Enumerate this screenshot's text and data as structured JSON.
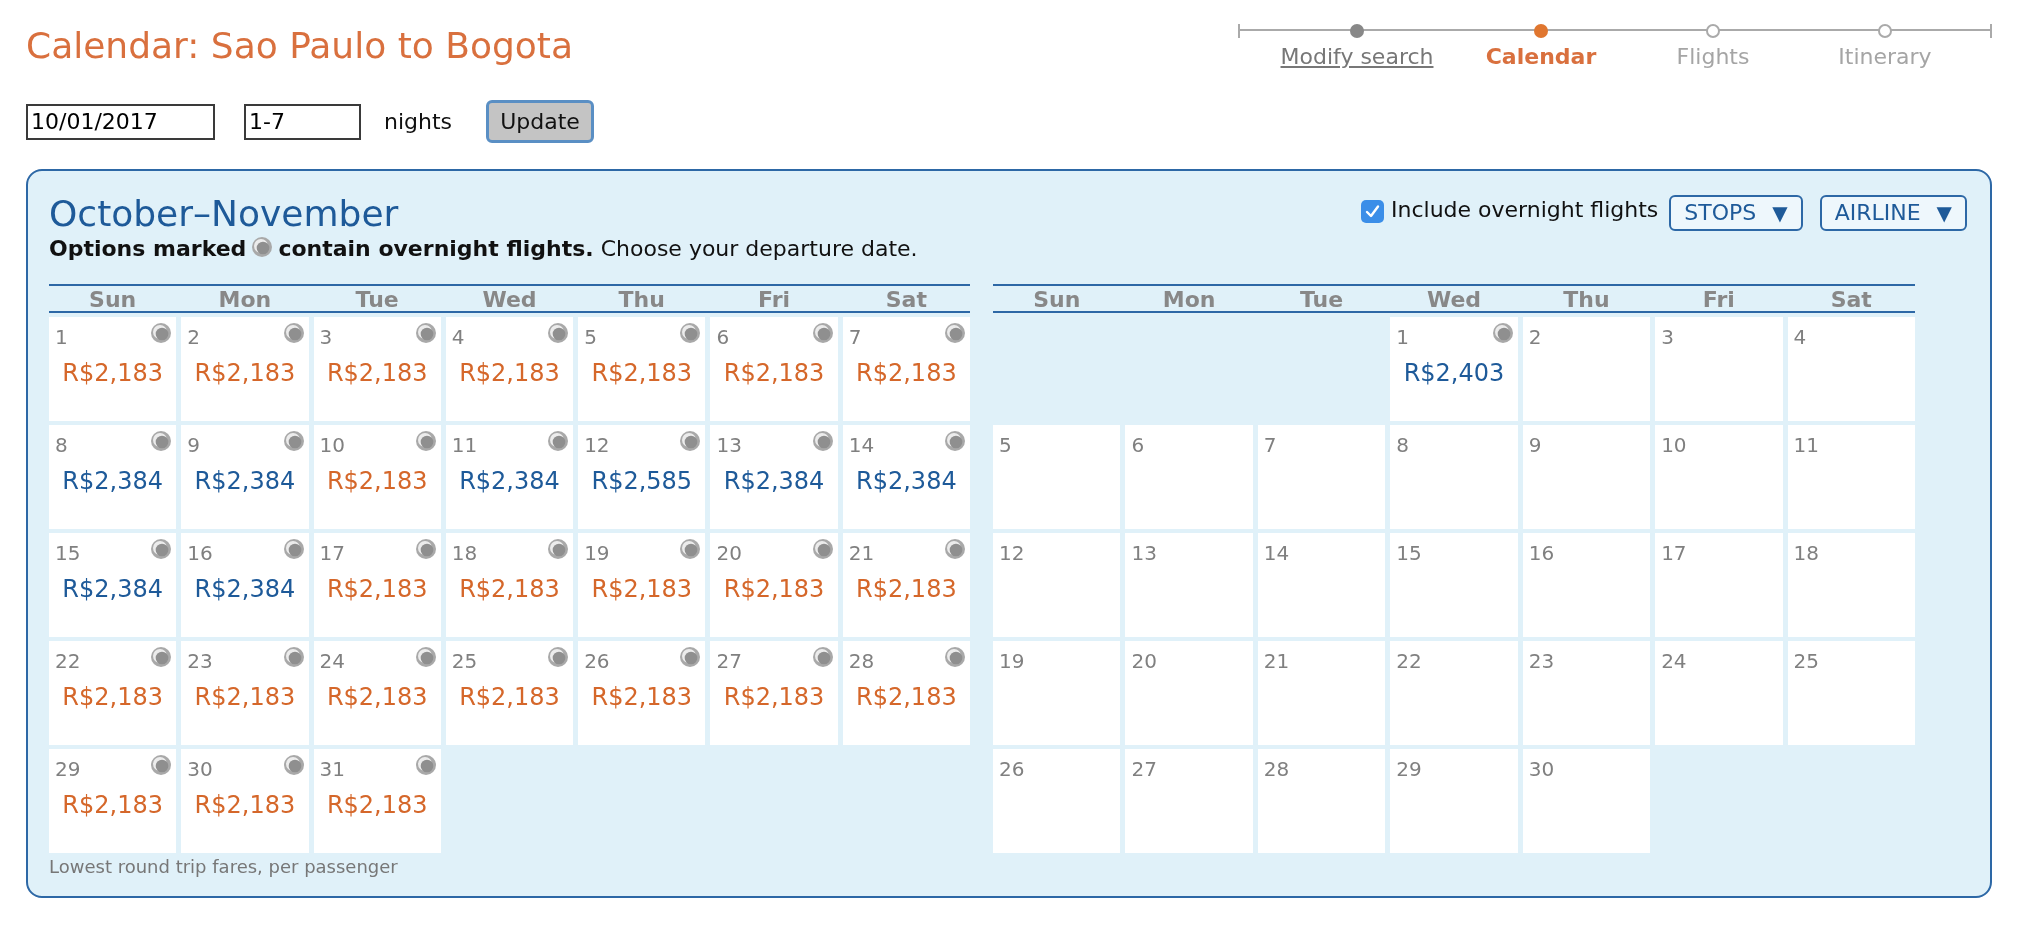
{
  "page": {
    "title": "Calendar: Sao Paulo to Bogota"
  },
  "steps": [
    {
      "label": "Modify search",
      "completed": true,
      "selected": false
    },
    {
      "label": "Calendar",
      "completed": false,
      "selected": true
    },
    {
      "label": "Flights",
      "completed": false,
      "selected": false
    },
    {
      "label": "Itinerary",
      "completed": false,
      "selected": false
    }
  ],
  "search_form": {
    "departure_date": "10/01/2017",
    "nights_range": "1-7",
    "nights_label": "nights",
    "update_button": "Update"
  },
  "calendar": {
    "title": "October–November",
    "legend_start": "Options marked",
    "legend_end": "**contain overnight flights.** Choose your departure date.",
    "include_overnight": {
      "label": "Include overnight flights",
      "checked": true
    },
    "filters": [
      {
        "label": "STOPS",
        "caret": "▼"
      },
      {
        "label": "AIRLINE",
        "caret": "▼"
      }
    ],
    "months": [
      {
        "weekdays": [
          "Sun",
          "Mon",
          "Tue",
          "Wed",
          "Thu",
          "Fri",
          "Sat"
        ],
        "weeks": [
          [
            {
              "day": "1",
              "overnight": true,
              "price": "R$2,183",
              "color": "#d5672a"
            },
            {
              "day": "2",
              "overnight": true,
              "price": "R$2,183",
              "color": "#d5672a"
            },
            {
              "day": "3",
              "overnight": true,
              "price": "R$2,183",
              "color": "#d5672a"
            },
            {
              "day": "4",
              "overnight": true,
              "price": "R$2,183",
              "color": "#d5672a"
            },
            {
              "day": "5",
              "overnight": true,
              "price": "R$2,183",
              "color": "#d5672a"
            },
            {
              "day": "6",
              "overnight": true,
              "price": "R$2,183",
              "color": "#d5672a"
            },
            {
              "day": "7",
              "overnight": true,
              "price": "R$2,183",
              "color": "#d5672a"
            }
          ],
          [
            {
              "day": "8",
              "overnight": true,
              "price": "R$2,384",
              "color": "#1e5a99"
            },
            {
              "day": "9",
              "overnight": true,
              "price": "R$2,384",
              "color": "#1e5a99"
            },
            {
              "day": "10",
              "overnight": true,
              "price": "R$2,183",
              "color": "#d5672a"
            },
            {
              "day": "11",
              "overnight": true,
              "price": "R$2,384",
              "color": "#1e5a99"
            },
            {
              "day": "12",
              "overnight": true,
              "price": "R$2,585",
              "color": "#1e5a99"
            },
            {
              "day": "13",
              "overnight": true,
              "price": "R$2,384",
              "color": "#1e5a99"
            },
            {
              "day": "14",
              "overnight": true,
              "price": "R$2,384",
              "color": "#1e5a99"
            }
          ],
          [
            {
              "day": "15",
              "overnight": true,
              "price": "R$2,384",
              "color": "#1e5a99"
            },
            {
              "day": "16",
              "overnight": true,
              "price": "R$2,384",
              "color": "#1e5a99"
            },
            {
              "day": "17",
              "overnight": true,
              "price": "R$2,183",
              "color": "#d5672a"
            },
            {
              "day": "18",
              "overnight": true,
              "price": "R$2,183",
              "color": "#d5672a"
            },
            {
              "day": "19",
              "overnight": true,
              "price": "R$2,183",
              "color": "#d5672a"
            },
            {
              "day": "20",
              "overnight": true,
              "price": "R$2,183",
              "color": "#d5672a"
            },
            {
              "day": "21",
              "overnight": true,
              "price": "R$2,183",
              "color": "#d5672a"
            }
          ],
          [
            {
              "day": "22",
              "overnight": true,
              "price": "R$2,183",
              "color": "#d5672a"
            },
            {
              "day": "23",
              "overnight": true,
              "price": "R$2,183",
              "color": "#d5672a"
            },
            {
              "day": "24",
              "overnight": true,
              "price": "R$2,183",
              "color": "#d5672a"
            },
            {
              "day": "25",
              "overnight": true,
              "price": "R$2,183",
              "color": "#d5672a"
            },
            {
              "day": "26",
              "overnight": true,
              "price": "R$2,183",
              "color": "#d5672a"
            },
            {
              "day": "27",
              "overnight": true,
              "price": "R$2,183",
              "color": "#d5672a"
            },
            {
              "day": "28",
              "overnight": true,
              "price": "R$2,183",
              "color": "#d5672a"
            }
          ],
          [
            {
              "day": "29",
              "overnight": true,
              "price": "R$2,183",
              "color": "#d5672a"
            },
            {
              "day": "30",
              "overnight": true,
              "price": "R$2,183",
              "color": "#d5672a"
            },
            {
              "day": "31",
              "overnight": true,
              "price": "R$2,183",
              "color": "#d5672a"
            }
          ]
        ]
      },
      {
        "weekdays": [
          "Sun",
          "Mon",
          "Tue",
          "Wed",
          "Thu",
          "Fri",
          "Sat"
        ],
        "weeks": [
          [
            {
              "day": "1",
              "overnight": true,
              "price": "R$2,403",
              "color": "#1e5a99"
            },
            {
              "day": "2",
              "overnight": false
            },
            {
              "day": "3",
              "overnight": false
            },
            {
              "day": "4",
              "overnight": false
            }
          ],
          [
            {
              "day": "5",
              "overnight": false
            },
            {
              "day": "6",
              "overnight": false
            },
            {
              "day": "7",
              "overnight": false
            },
            {
              "day": "8",
              "overnight": false
            },
            {
              "day": "9",
              "overnight": false
            },
            {
              "day": "10",
              "overnight": false
            },
            {
              "day": "11",
              "overnight": false
            }
          ],
          [
            {
              "day": "12",
              "overnight": false
            },
            {
              "day": "13",
              "overnight": false
            },
            {
              "day": "14",
              "overnight": false
            },
            {
              "day": "15",
              "overnight": false
            },
            {
              "day": "16",
              "overnight": false
            },
            {
              "day": "17",
              "overnight": false
            },
            {
              "day": "18",
              "overnight": false
            }
          ],
          [
            {
              "day": "19",
              "overnight": false
            },
            {
              "day": "20",
              "overnight": false
            },
            {
              "day": "21",
              "overnight": false
            },
            {
              "day": "22",
              "overnight": false
            },
            {
              "day": "23",
              "overnight": false
            },
            {
              "day": "24",
              "overnight": false
            },
            {
              "day": "25",
              "overnight": false
            }
          ],
          [
            {
              "day": "26",
              "overnight": false
            },
            {
              "day": "27",
              "overnight": false
            },
            {
              "day": "28",
              "overnight": false
            },
            {
              "day": "29",
              "overnight": false
            },
            {
              "day": "30",
              "overnight": false
            }
          ]
        ]
      }
    ],
    "footnote": "Lowest round trip fares, per passenger"
  }
}
